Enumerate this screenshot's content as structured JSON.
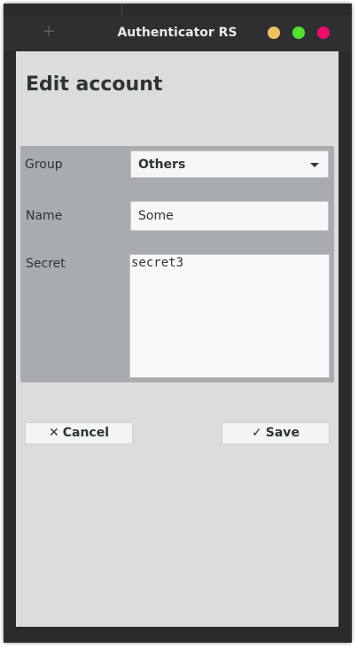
{
  "window": {
    "title": "Authenticator RS",
    "add_tab_glyph": "+",
    "controls": {
      "minimize_color": "#f0c060",
      "maximize_color": "#52e02c",
      "close_color": "#f20a6a"
    }
  },
  "page": {
    "heading": "Edit account"
  },
  "form": {
    "group_label": "Group",
    "group_value": "Others",
    "name_label": "Name",
    "name_value": "Some",
    "secret_label": "Secret",
    "secret_value": "secret3"
  },
  "actions": {
    "cancel_icon": "✕",
    "cancel_label": "Cancel",
    "save_icon": "✓",
    "save_label": "Save"
  }
}
